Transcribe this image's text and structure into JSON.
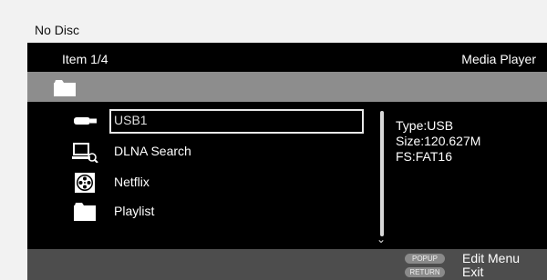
{
  "top": {
    "disc_status": "No Disc"
  },
  "header": {
    "item_count": "Item 1/4",
    "app_name": "Media Player"
  },
  "pathbar": {
    "icon": "folder-icon"
  },
  "list": {
    "items": [
      {
        "label": "USB1",
        "icon": "usb-drive-icon",
        "selected": true
      },
      {
        "label": "DLNA Search",
        "icon": "network-search-icon",
        "selected": false
      },
      {
        "label": "Netflix",
        "icon": "film-reel-icon",
        "selected": false
      },
      {
        "label": "Playlist",
        "icon": "folder-icon",
        "selected": false
      }
    ]
  },
  "info": {
    "type": "Type:USB",
    "size": "Size:120.627M",
    "fs": "FS:FAT16"
  },
  "footer": {
    "popup_key": "POPUP",
    "popup_action": "Edit Menu",
    "return_key": "RETURN",
    "return_action": "Exit"
  },
  "colors": {
    "background": "#000000",
    "header_strip": "#8d8d8d",
    "footer_bar": "#4d4d4d",
    "text": "#ffffff"
  }
}
